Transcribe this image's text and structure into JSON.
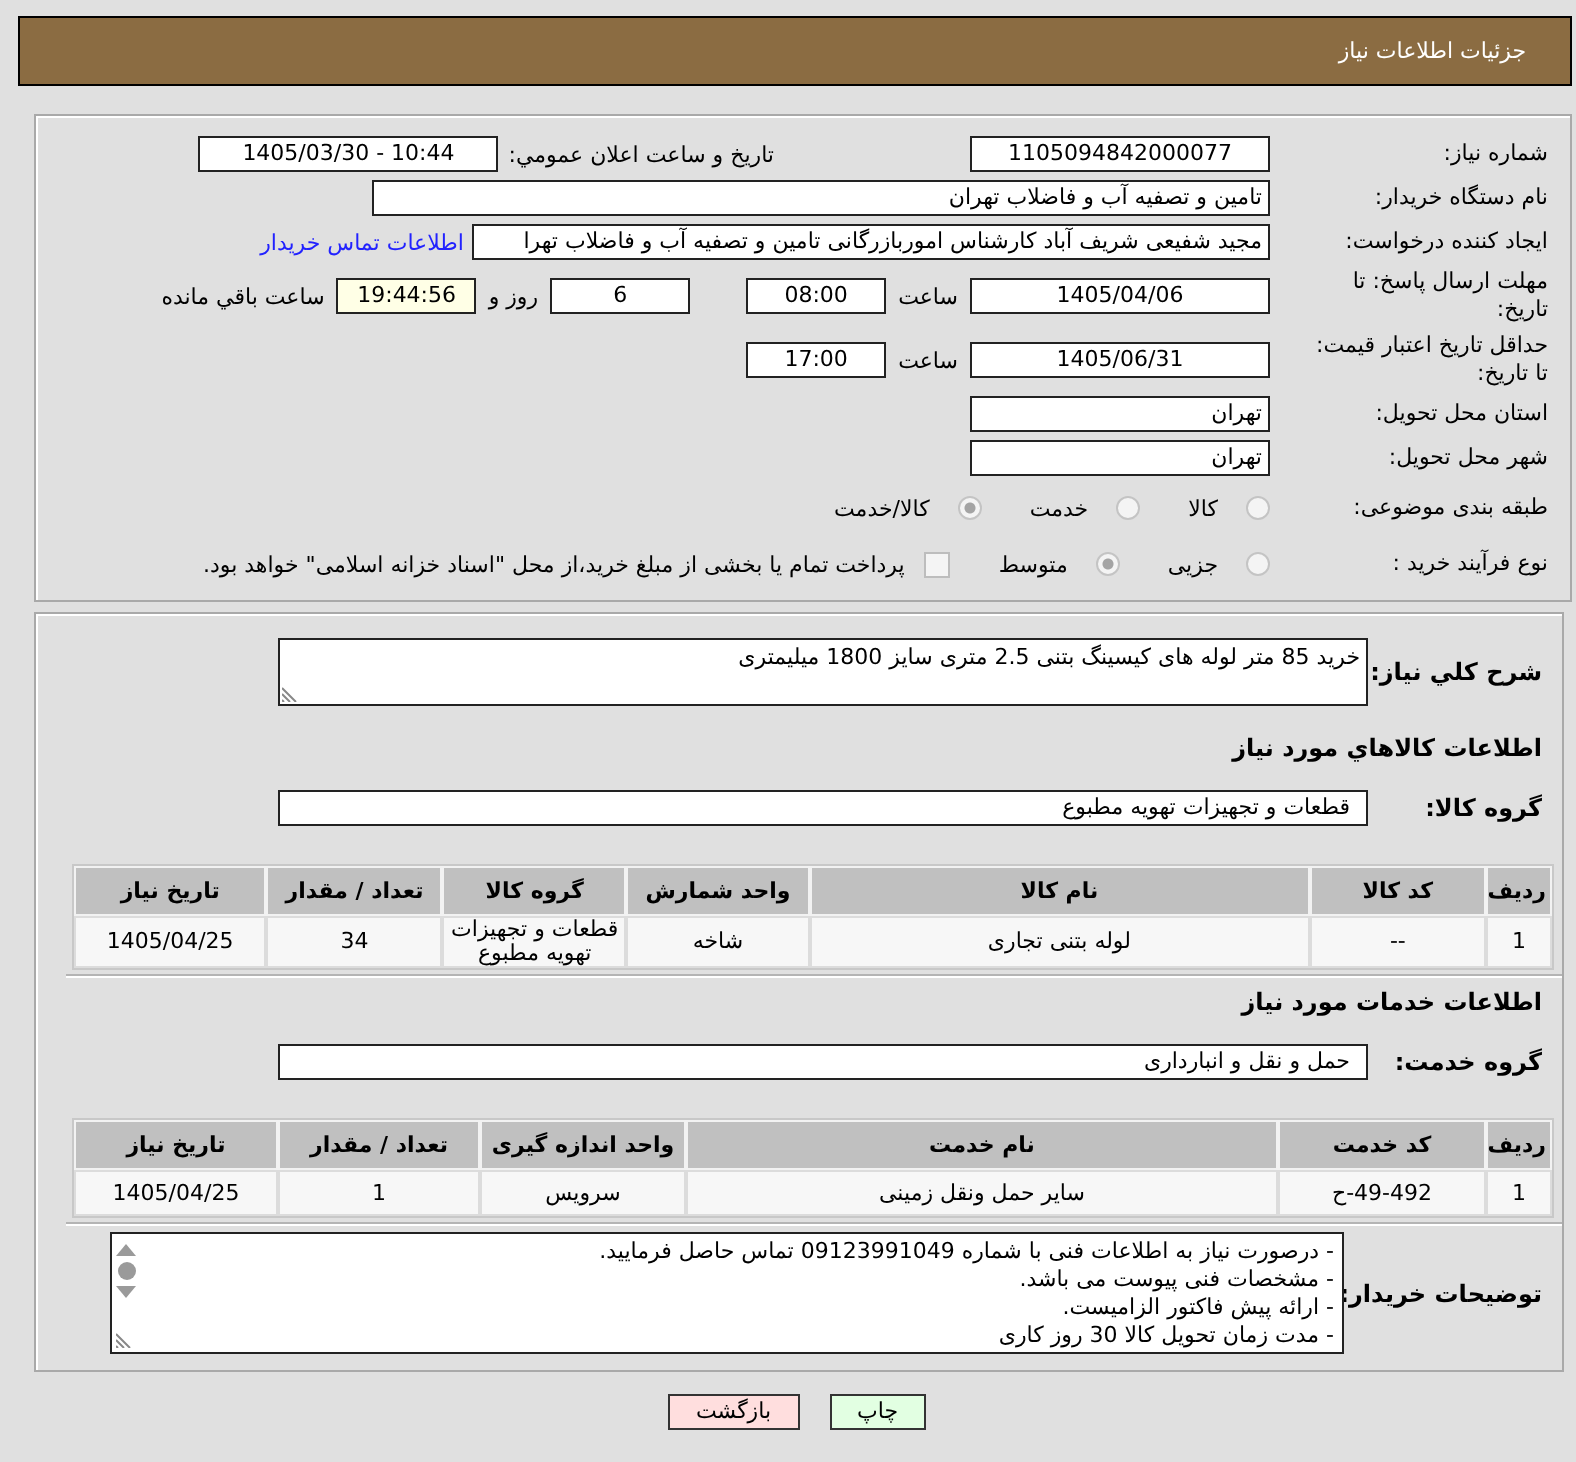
{
  "header": {
    "title": "جزئیات اطلاعات نیاز"
  },
  "details": {
    "need_number": {
      "label": "شماره نیاز:",
      "value": "1105094842000077"
    },
    "announcement": {
      "label": "تاریخ و ساعت اعلان عمومي:",
      "value": "1405/03/30 - 10:44"
    },
    "buyer_org": {
      "label": "نام دستگاه خریدار:",
      "value": "تامین و تصفیه آب و فاضلاب تهران"
    },
    "requester": {
      "label": "ایجاد کننده درخواست:",
      "value": "مجید شفیعی شریف آباد کارشناس اموربازرگانی تامین و تصفیه آب و فاضلاب تهرا",
      "contact_link": "اطلاعات تماس خریدار"
    },
    "reply_deadline": {
      "label": "مهلت ارسال پاسخ: تا تاریخ:",
      "date": "1405/04/06",
      "time_label": "ساعت",
      "time": "08:00",
      "days": "6",
      "days_label": "روز و",
      "remaining": "19:44:56",
      "remaining_label": "ساعت باقي مانده"
    },
    "price_validity": {
      "label": "حداقل تاریخ اعتبار قیمت: تا تاریخ:",
      "date": "1405/06/31",
      "time_label": "ساعت",
      "time": "17:00"
    },
    "delivery_province": {
      "label": "استان محل تحویل:",
      "value": "تهران"
    },
    "delivery_city": {
      "label": "شهر محل تحویل:",
      "value": "تهران"
    },
    "subject_category": {
      "label": "طبقه بندی موضوعی:",
      "options": [
        {
          "label": "کالا",
          "selected": false
        },
        {
          "label": "خدمت",
          "selected": false
        },
        {
          "label": "کالا/خدمت",
          "selected": true
        }
      ]
    },
    "purchase_process": {
      "label": "نوع فرآیند خرید :",
      "options": [
        {
          "label": "جزیی",
          "selected": false
        },
        {
          "label": "متوسط",
          "selected": true
        }
      ],
      "treasury_payment": {
        "label": "پرداخت تمام یا بخشی از مبلغ خرید،از محل \"اسناد خزانه اسلامی\" خواهد بود.",
        "checked": false
      }
    }
  },
  "need": {
    "description": {
      "label": "شرح کلي نیاز:",
      "value": "خرید 85 متر لوله های کیسینگ بتنی 2.5 متری سایز 1800 میلیمتری"
    },
    "goods": {
      "title": "اطلاعات کالاهاي مورد نیاز",
      "group_label": "گروه کالا:",
      "group": "قطعات و تجهیزات تهویه مطبوع",
      "table": {
        "columns": [
          "ردیف",
          "کد کالا",
          "نام کالا",
          "واحد شمارش",
          "گروه کالا",
          "تعداد / مقدار",
          "تاریخ نیاز"
        ],
        "rows": [
          [
            "1",
            "--",
            "لوله بتنی تجاری",
            "شاخه",
            "قطعات و تجهیزات تهویه مطبوع",
            "34",
            "1405/04/25"
          ]
        ]
      }
    },
    "services": {
      "title": "اطلاعات خدمات مورد نیاز",
      "group_label": "گروه خدمت:",
      "group": "حمل و نقل و انبارداری",
      "table": {
        "columns": [
          "ردیف",
          "کد خدمت",
          "نام خدمت",
          "واحد اندازه گیری",
          "تعداد / مقدار",
          "تاریخ نیاز"
        ],
        "rows": [
          [
            "1",
            "ح-49-492",
            "سایر حمل ونقل زمینی",
            "سرویس",
            "1",
            "1405/04/25"
          ]
        ]
      }
    },
    "buyer_notes": {
      "label": "توضیحات خریدار:",
      "lines": [
        "- درصورت نیاز به اطلاعات فنی با شماره 09123991049 تماس حاصل فرمایید.",
        "- مشخصات فنی پیوست می باشد.",
        "- ارائه پیش فاکتور الزامیست.",
        "- مدت زمان تحویل کالا 30 روز کاری"
      ]
    }
  },
  "buttons": [
    {
      "label": "چاپ",
      "kind": "print"
    },
    {
      "label": "بازگشت",
      "kind": "back"
    }
  ]
}
